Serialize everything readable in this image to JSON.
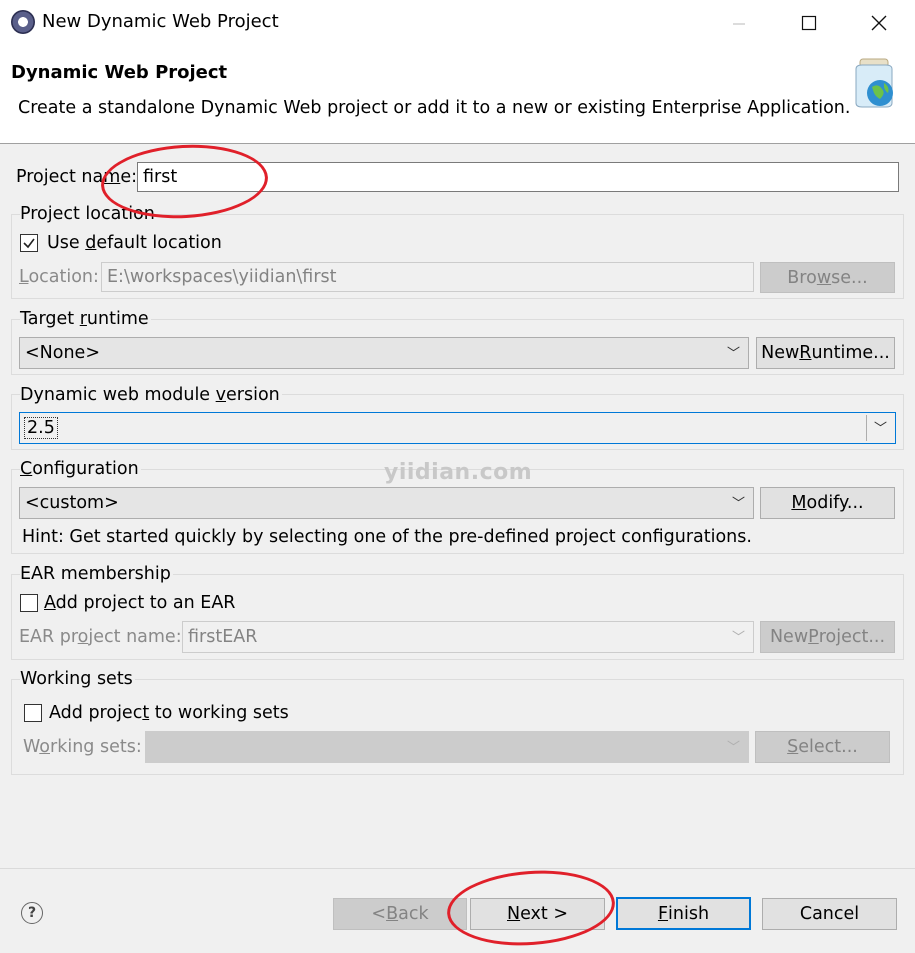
{
  "window": {
    "title": "New Dynamic Web Project"
  },
  "header": {
    "title": "Dynamic Web Project",
    "description": "Create a standalone Dynamic Web project or add it to a new or existing Enterprise Application."
  },
  "project_name": {
    "label": "Project name:",
    "value": "first"
  },
  "project_location": {
    "group_label": "Project location",
    "use_default_label": "Use default location",
    "use_default_checked": true,
    "location_label": "Location:",
    "location_value": "E:\\workspaces\\yiidian\\first",
    "browse_label": "Browse..."
  },
  "target_runtime": {
    "group_label": "Target runtime",
    "selected": "<None>",
    "new_runtime_label": "New Runtime..."
  },
  "module_version": {
    "group_label": "Dynamic web module version",
    "selected": "2.5"
  },
  "configuration": {
    "group_label": "Configuration",
    "selected": "<custom>",
    "modify_label": "Modify...",
    "hint": "Hint: Get started quickly by selecting one of the pre-defined project configurations."
  },
  "ear_membership": {
    "group_label": "EAR membership",
    "add_label": "Add project to an EAR",
    "add_checked": false,
    "ear_name_label": "EAR project name:",
    "ear_name_value": "firstEAR",
    "new_project_label": "New Project..."
  },
  "working_sets": {
    "group_label": "Working sets",
    "add_label": "Add project to working sets",
    "add_checked": false,
    "sets_label": "Working sets:",
    "sets_value": "",
    "select_label": "Select..."
  },
  "watermark": "yiidian.com",
  "footer": {
    "back_label": "< Back",
    "next_label": "Next >",
    "finish_label": "Finish",
    "cancel_label": "Cancel"
  },
  "colors": {
    "annotation_red": "#e0202a",
    "focus_blue": "#0078d7"
  },
  "icons": [
    "eclipse-app-icon",
    "minimize-icon",
    "maximize-icon",
    "close-icon",
    "web-project-jar-icon",
    "checkmark-icon",
    "dropdown-arrow-icon",
    "help-icon"
  ]
}
